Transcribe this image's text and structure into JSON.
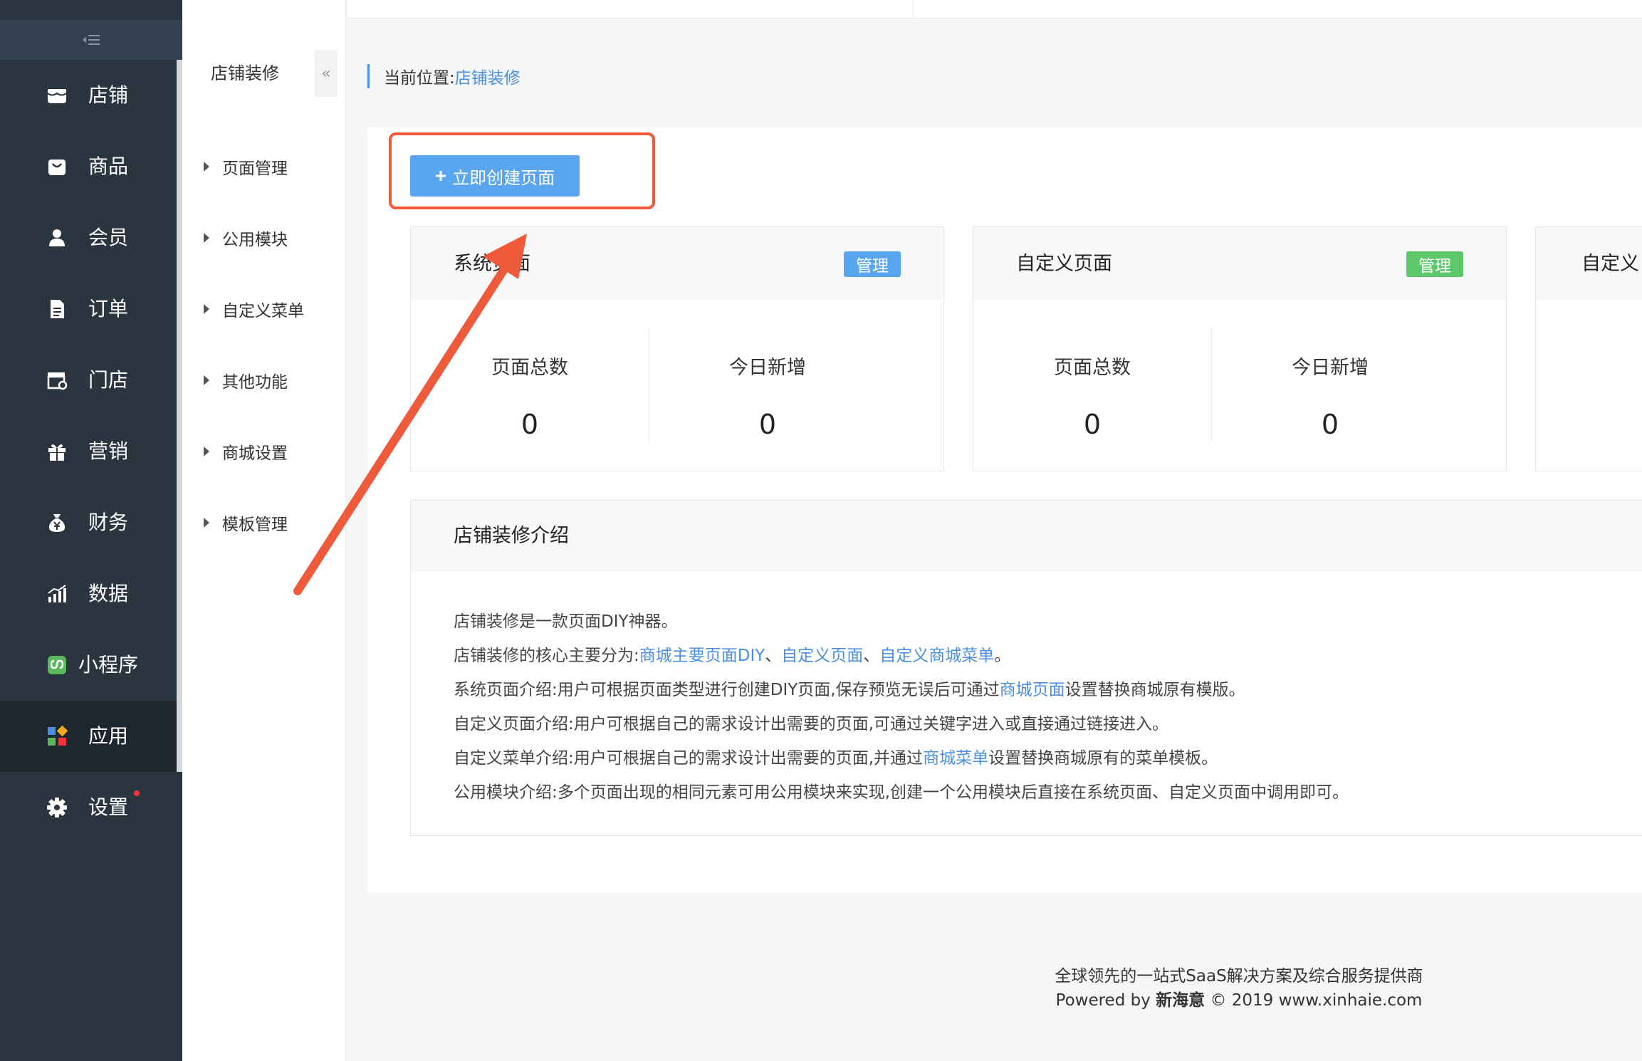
{
  "sidebar": {
    "collapse_icon": "collapse-menu-icon",
    "items": [
      {
        "label": "店铺",
        "icon": "store-icon"
      },
      {
        "label": "商品",
        "icon": "bag-icon"
      },
      {
        "label": "会员",
        "icon": "user-icon"
      },
      {
        "label": "订单",
        "icon": "document-icon"
      },
      {
        "label": "门店",
        "icon": "shop-icon"
      },
      {
        "label": "营销",
        "icon": "gift-icon"
      },
      {
        "label": "财务",
        "icon": "money-bag-icon"
      },
      {
        "label": "数据",
        "icon": "bar-chart-icon"
      },
      {
        "label": "小程序",
        "icon": "miniprogram-icon"
      },
      {
        "label": "应用",
        "icon": "apps-icon"
      },
      {
        "label": "设置",
        "icon": "gear-icon"
      }
    ],
    "active": "应用"
  },
  "subsidebar": {
    "title": "店铺装修",
    "collapse_glyph": "«",
    "items": [
      {
        "label": "页面管理"
      },
      {
        "label": "公用模块"
      },
      {
        "label": "自定义菜单"
      },
      {
        "label": "其他功能"
      },
      {
        "label": "商城设置"
      },
      {
        "label": "模板管理"
      }
    ]
  },
  "breadcrumb": {
    "prefix": "当前位置:",
    "current": "店铺装修"
  },
  "create_button": {
    "label": "立即创建页面",
    "glyph": "+"
  },
  "cards": [
    {
      "title": "系统页面",
      "badge": "管理",
      "badge_color": "#5aa5f0",
      "stats": [
        {
          "label": "页面总数",
          "value": "0"
        },
        {
          "label": "今日新增",
          "value": "0"
        }
      ]
    },
    {
      "title": "自定义页面",
      "badge": "管理",
      "badge_color": "#5cc86a",
      "stats": [
        {
          "label": "页面总数",
          "value": "0"
        },
        {
          "label": "今日新增",
          "value": "0"
        }
      ]
    },
    {
      "title": "自定义"
    }
  ],
  "intro": {
    "title": "店铺装修介绍",
    "line1": "店铺装修是一款页面DIY神器。",
    "line2": {
      "prefix": "店铺装修的核心主要分为:",
      "link1": "商城主要页面DIY",
      "sep1": "、",
      "link2": "自定义页面",
      "sep2": "、",
      "link3": "自定义商城菜单",
      "suffix": "。"
    },
    "line3": {
      "prefix": "系统页面介绍:用户可根据页面类型进行创建DIY页面,保存预览无误后可通过",
      "link": "商城页面",
      "suffix": "设置替换商城原有模版。"
    },
    "line4": "自定义页面介绍:用户可根据自己的需求设计出需要的页面,可通过关键字进入或直接通过链接进入。",
    "line5": {
      "prefix": "自定义菜单介绍:用户可根据自己的需求设计出需要的页面,并通过",
      "link": "商城菜单",
      "suffix": "设置替换商城原有的菜单模板。"
    },
    "line6": "公用模块介绍:多个页面出现的相同元素可用公用模块来实现,创建一个公用模块后直接在系统页面、自定义页面中调用即可。"
  },
  "footer": {
    "line1": "全球领先的一站式SaaS解决方案及综合服务提供商",
    "powered": "Powered by",
    "brand": "新海意",
    "copyright": "© 2019 www.xinhaie.com"
  },
  "colors": {
    "accent": "#4a90e2",
    "annotation": "#ee5a3a"
  }
}
